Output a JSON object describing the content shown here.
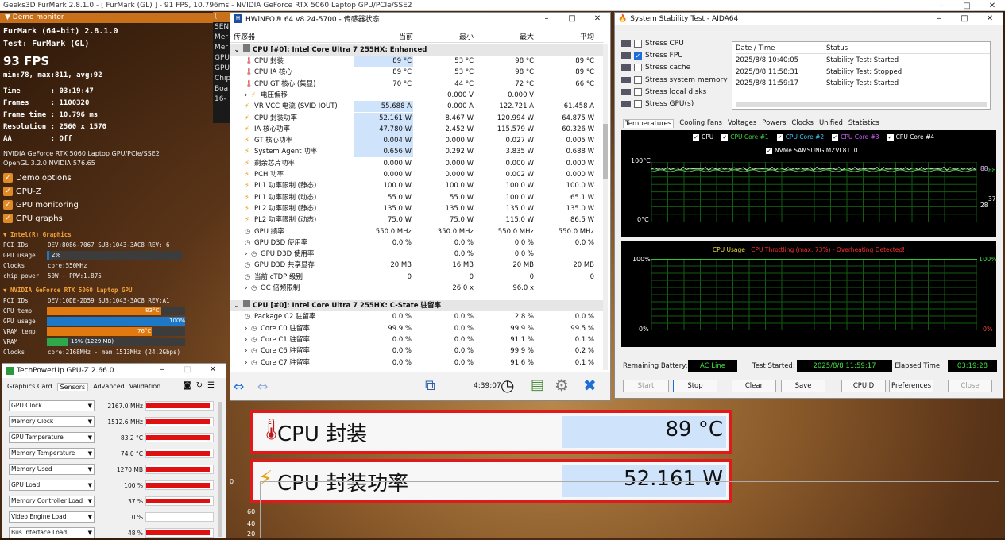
{
  "topbar": {
    "title": "Geeks3D FurMark 2.8.1.0 - [ FurMark (GL) ] - 91 FPS, 10.796ms - NVIDIA GeForce RTX 5060 Laptop GPU/PCIe/SSE2"
  },
  "furmark": {
    "demo_monitor": "Demo monitor",
    "line1": "FurMark (64-bit) 2.8.1.0",
    "line2": "Test: FurMark (GL)",
    "fps": "93 FPS",
    "minmax": "min:78, max:811, avg:92",
    "time": "Time       : 03:19:47",
    "frames": "Frames     : 1100320",
    "frametime": "Frame time : 10.796 ms",
    "resolution": "Resolution : 2560 x 1570",
    "aa": "AA         : Off",
    "gpu_name": "NVIDIA GeForce RTX 5060 Laptop GPU/PCIe/SSE2",
    "opengl": "OpenGL 3.2.0 NVIDIA 576.65",
    "checks": [
      "Demo options",
      "GPU-Z",
      "GPU monitoring",
      "GPU graphs"
    ],
    "intel": {
      "title": "▼ Intel(R) Graphics",
      "pci_label": "PCI IDs",
      "pci": "DEV:8086-7067 SUB:1043-3AC8 REV: 6",
      "usage_label": "GPU usage",
      "usage": "2%",
      "usage_pct": 2,
      "clocks_label": "Clocks",
      "clocks": "core:550MHz",
      "power_label": "chip power",
      "power": "50W - PPW:1.875"
    },
    "nvidia": {
      "title": "▼ NVIDIA GeForce RTX 5060 Laptop GPU",
      "pci_label": "PCI IDs",
      "pci": "DEV:10DE-2D59 SUB:1043-3AC8 REV:A1",
      "temp_label": "GPU temp",
      "temp": "83°C",
      "temp_pct": 83,
      "usage_label": "GPU usage",
      "usage": "100%",
      "usage_pct": 100,
      "vramtemp_label": "VRAM temp",
      "vramtemp": "76°C",
      "vramtemp_pct": 76,
      "vram_label": "VRAM",
      "vram": "15% (1229 MB)",
      "vram_pct": 15,
      "clocks_label": "Clocks",
      "clocks": "core:2168MHz - mem:1513MHz (24.2Gbps)"
    },
    "behind_panel": [
      "SEN",
      "Mer",
      "Mer",
      "GPU",
      "GPU",
      "Chip",
      "Boa",
      "16-"
    ]
  },
  "gpuz": {
    "title": "TechPowerUp GPU-Z 2.66.0",
    "tabs": [
      "Graphics Card",
      "Sensors",
      "Advanced",
      "Validation"
    ],
    "rows": [
      {
        "label": "GPU Clock",
        "value": "2167.0 MHz",
        "pct": 95
      },
      {
        "label": "Memory Clock",
        "value": "1512.6 MHz",
        "pct": 95
      },
      {
        "label": "GPU Temperature",
        "value": "83.2 °C",
        "pct": 95
      },
      {
        "label": "Memory Temperature",
        "value": "74.0 °C",
        "pct": 95
      },
      {
        "label": "Memory Used",
        "value": "1270 MB",
        "pct": 95
      },
      {
        "label": "GPU Load",
        "value": "100 %",
        "pct": 95
      },
      {
        "label": "Memory Controller Load",
        "value": "37 %",
        "pct": 95
      },
      {
        "label": "Video Engine Load",
        "value": "0 %",
        "pct": 0
      },
      {
        "label": "Bus Interface Load",
        "value": "48 %",
        "pct": 95
      }
    ]
  },
  "hwinfo": {
    "title": "HWiNFO® 64 v8.24-5700 - 传感器状态",
    "headers": [
      "传感器",
      "当前",
      "最小",
      "最大",
      "平均"
    ],
    "group1": "CPU [#0]: Intel Core Ultra 7 255HX: Enhanced",
    "rows1": [
      {
        "icon": "temp",
        "name": "CPU 封装",
        "cur": "89 °C",
        "min": "53 °C",
        "max": "98 °C",
        "avg": "89 °C",
        "hl": true
      },
      {
        "icon": "temp",
        "name": "CPU IA 核心",
        "cur": "89 °C",
        "min": "53 °C",
        "max": "98 °C",
        "avg": "89 °C"
      },
      {
        "icon": "temp",
        "name": "CPU GT 核心 (集显)",
        "cur": "70 °C",
        "min": "44 °C",
        "max": "72 °C",
        "avg": "66 °C"
      },
      {
        "icon": "bolt",
        "name": "电压偏移",
        "cur": "",
        "min": "0.000 V",
        "max": "0.000 V",
        "avg": "",
        "exp": true
      },
      {
        "icon": "bolt",
        "name": "VR VCC 电流 (SVID IOUT)",
        "cur": "55.688 A",
        "min": "0.000 A",
        "max": "122.721 A",
        "avg": "61.458 A",
        "hl": true
      },
      {
        "icon": "bolt",
        "name": "CPU 封装功率",
        "cur": "52.161 W",
        "min": "8.467 W",
        "max": "120.994 W",
        "avg": "64.875 W",
        "hl": true
      },
      {
        "icon": "bolt",
        "name": "IA 核心功率",
        "cur": "47.780 W",
        "min": "2.452 W",
        "max": "115.579 W",
        "avg": "60.326 W",
        "hl": true
      },
      {
        "icon": "bolt",
        "name": "GT 核心功率",
        "cur": "0.004 W",
        "min": "0.000 W",
        "max": "0.027 W",
        "avg": "0.005 W",
        "hl": true
      },
      {
        "icon": "bolt",
        "name": "System Agent 功率",
        "cur": "0.656 W",
        "min": "0.292 W",
        "max": "3.835 W",
        "avg": "0.688 W",
        "hl": true
      },
      {
        "icon": "bolt",
        "name": "剩余芯片功率",
        "cur": "0.000 W",
        "min": "0.000 W",
        "max": "0.000 W",
        "avg": "0.000 W"
      },
      {
        "icon": "bolt",
        "name": "PCH 功率",
        "cur": "0.000 W",
        "min": "0.000 W",
        "max": "0.002 W",
        "avg": "0.000 W"
      },
      {
        "icon": "bolt",
        "name": "PL1 功率限制 (静态)",
        "cur": "100.0 W",
        "min": "100.0 W",
        "max": "100.0 W",
        "avg": "100.0 W"
      },
      {
        "icon": "bolt",
        "name": "PL1 功率限制 (动态)",
        "cur": "55.0 W",
        "min": "55.0 W",
        "max": "100.0 W",
        "avg": "65.1 W"
      },
      {
        "icon": "bolt",
        "name": "PL2 功率限制 (静态)",
        "cur": "135.0 W",
        "min": "135.0 W",
        "max": "135.0 W",
        "avg": "135.0 W"
      },
      {
        "icon": "bolt",
        "name": "PL2 功率限制 (动态)",
        "cur": "75.0 W",
        "min": "75.0 W",
        "max": "115.0 W",
        "avg": "86.5 W"
      },
      {
        "icon": "clock",
        "name": "GPU 频率",
        "cur": "550.0 MHz",
        "min": "350.0 MHz",
        "max": "550.0 MHz",
        "avg": "550.0 MHz"
      },
      {
        "icon": "clock",
        "name": "GPU D3D 使用率",
        "cur": "0.0 %",
        "min": "0.0 %",
        "max": "0.0 %",
        "avg": "0.0 %"
      },
      {
        "icon": "clock",
        "name": "GPU D3D 使用率",
        "cur": "",
        "min": "0.0 %",
        "max": "0.0 %",
        "avg": "",
        "exp": true
      },
      {
        "icon": "clock",
        "name": "GPU D3D 共享显存",
        "cur": "20 MB",
        "min": "16 MB",
        "max": "20 MB",
        "avg": "20 MB"
      },
      {
        "icon": "clock",
        "name": "当前 cTDP 级别",
        "cur": "0",
        "min": "0",
        "max": "0",
        "avg": "0"
      },
      {
        "icon": "clock",
        "name": "OC 倍频限制",
        "cur": "",
        "min": "26.0 x",
        "max": "96.0 x",
        "avg": "",
        "exp": true
      }
    ],
    "group2": "CPU [#0]: Intel Core Ultra 7 255HX: C-State 驻留率",
    "rows2": [
      {
        "icon": "clock",
        "name": "Package C2 驻留率",
        "cur": "0.0 %",
        "min": "0.0 %",
        "max": "2.8 %",
        "avg": "0.0 %"
      },
      {
        "icon": "clock",
        "name": "Core C0 驻留率",
        "cur": "99.9 %",
        "min": "0.0 %",
        "max": "99.9 %",
        "avg": "99.5 %",
        "exp": true
      },
      {
        "icon": "clock",
        "name": "Core C1 驻留率",
        "cur": "0.0 %",
        "min": "0.0 %",
        "max": "91.1 %",
        "avg": "0.1 %",
        "exp": true
      },
      {
        "icon": "clock",
        "name": "Core C6 驻留率",
        "cur": "0.0 %",
        "min": "0.0 %",
        "max": "99.9 %",
        "avg": "0.2 %",
        "exp": true
      },
      {
        "icon": "clock",
        "name": "Core C7 驻留率",
        "cur": "0.0 %",
        "min": "0.0 %",
        "max": "91.6 %",
        "avg": "0.1 %",
        "exp": true
      }
    ],
    "time": "4:39:07"
  },
  "magnified": [
    {
      "name": "CPU 封装",
      "value": "89 °C"
    },
    {
      "name": "CPU 封装功率",
      "value": "52.161 W"
    }
  ],
  "aida": {
    "title": "System Stability Test - AIDA64",
    "stress": [
      {
        "label": "Stress CPU",
        "on": false
      },
      {
        "label": "Stress FPU",
        "on": true
      },
      {
        "label": "Stress cache",
        "on": false
      },
      {
        "label": "Stress system memory",
        "on": false
      },
      {
        "label": "Stress local disks",
        "on": false
      },
      {
        "label": "Stress GPU(s)",
        "on": false
      }
    ],
    "log_headers": [
      "Date / Time",
      "Status"
    ],
    "log": [
      {
        "time": "2025/8/8 10:40:05",
        "status": "Stability Test: Started"
      },
      {
        "time": "2025/8/8 11:58:31",
        "status": "Stability Test: Stopped"
      },
      {
        "time": "2025/8/8 11:59:17",
        "status": "Stability Test: Started"
      }
    ],
    "tabs": [
      "Temperatures",
      "Cooling Fans",
      "Voltages",
      "Powers",
      "Clocks",
      "Unified",
      "Statistics"
    ],
    "legend": [
      "CPU",
      "CPU Core #1",
      "CPU Core #2",
      "CPU Core #3",
      "CPU Core #4"
    ],
    "legend2": "NVMe SAMSUNG MZVL81T0",
    "temp_top": "100°C",
    "temp_bottom": "0°C",
    "temp_r1": "88",
    "temp_r2": "88",
    "temp_r3": "37",
    "temp_r4": "28",
    "usage_title_a": "CPU Usage",
    "usage_sep": "|",
    "usage_title_b": "CPU Throttling (max: 73%) - Overheating Detected!",
    "usage_top": "100%",
    "usage_bottom": "0%",
    "usage_rtop": "100%",
    "usage_rbottom": "0%",
    "battery_label": "Remaining Battery:",
    "battery": "AC Line",
    "started_label": "Test Started:",
    "started": "2025/8/8 11:59:17",
    "elapsed_label": "Elapsed Time:",
    "elapsed": "03:19:28",
    "buttons": [
      "Start",
      "Stop",
      "Clear",
      "Save",
      "CPUID",
      "Preferences",
      "Close"
    ]
  },
  "bottom": {
    "labels": [
      "0",
      "60",
      "40",
      "20"
    ]
  }
}
